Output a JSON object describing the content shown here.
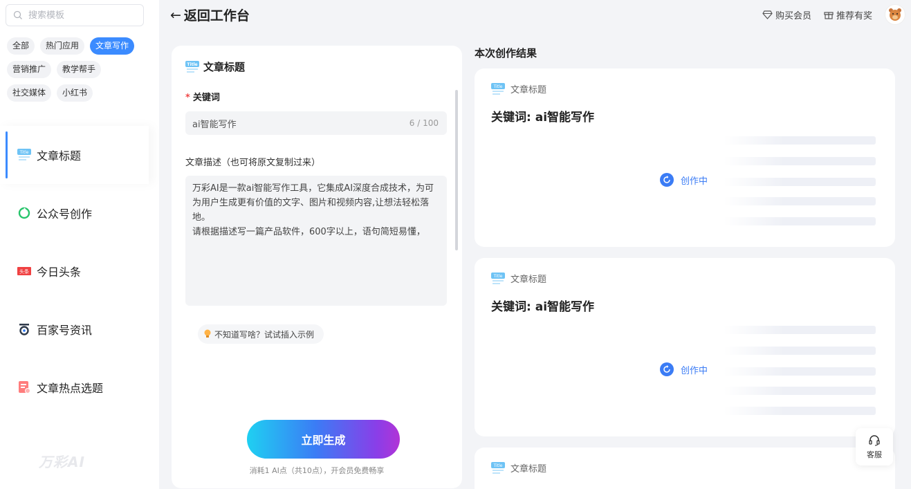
{
  "sidebar": {
    "search_placeholder": "搜索模板",
    "tags": [
      [
        "全部",
        "热门应用",
        "文章写作"
      ],
      [
        "营销推广",
        "教学帮手"
      ],
      [
        "社交媒体",
        "小红书"
      ]
    ],
    "active_tag": "文章写作",
    "nav": [
      {
        "label": "文章标题",
        "icon": "title-icon",
        "active": true
      },
      {
        "label": "公众号创作",
        "icon": "wechat-icon",
        "active": false
      },
      {
        "label": "今日头条",
        "icon": "toutiao-icon",
        "active": false
      },
      {
        "label": "百家号资讯",
        "icon": "baijiahao-icon",
        "active": false
      },
      {
        "label": "文章热点选题",
        "icon": "hot-topic-icon",
        "active": false
      }
    ],
    "brand": "万彩AI"
  },
  "header": {
    "back_label": "返回工作台",
    "buy_vip": "购买会员",
    "referral": "推荐有奖"
  },
  "form": {
    "title": "文章标题",
    "title_badge": "Title",
    "keyword_label": "关键词",
    "keyword_value": "ai智能写作",
    "keyword_count": "6 / 100",
    "desc_label": "文章描述（也可将原文复制过来）",
    "desc_value": "万彩AI是一款ai智能写作工具，它集成AI深度合成技术，为可为用户生成更有价值的文字、图片和视频内容,让想法轻松落地。\n请根据描述写一篇产品软件，600字以上，语句简短易懂，",
    "hint": "不知道写啥？试试插入示例",
    "generate": "立即生成",
    "cost": "消耗1 AI点（共10点），开会员免费畅享"
  },
  "results": {
    "heading": "本次创作结果",
    "cards": [
      {
        "type": "文章标题",
        "badge": "Title",
        "keyword": "关键词: ai智能写作",
        "status": "创作中"
      },
      {
        "type": "文章标题",
        "badge": "Title",
        "keyword": "关键词: ai智能写作",
        "status": "创作中"
      },
      {
        "type": "文章标题",
        "badge": "Title",
        "keyword": "",
        "status": ""
      }
    ]
  },
  "support": {
    "label": "客服"
  },
  "colors": {
    "accent": "#3b8bff",
    "status": "#3b7cf5",
    "required": "#f04747"
  }
}
